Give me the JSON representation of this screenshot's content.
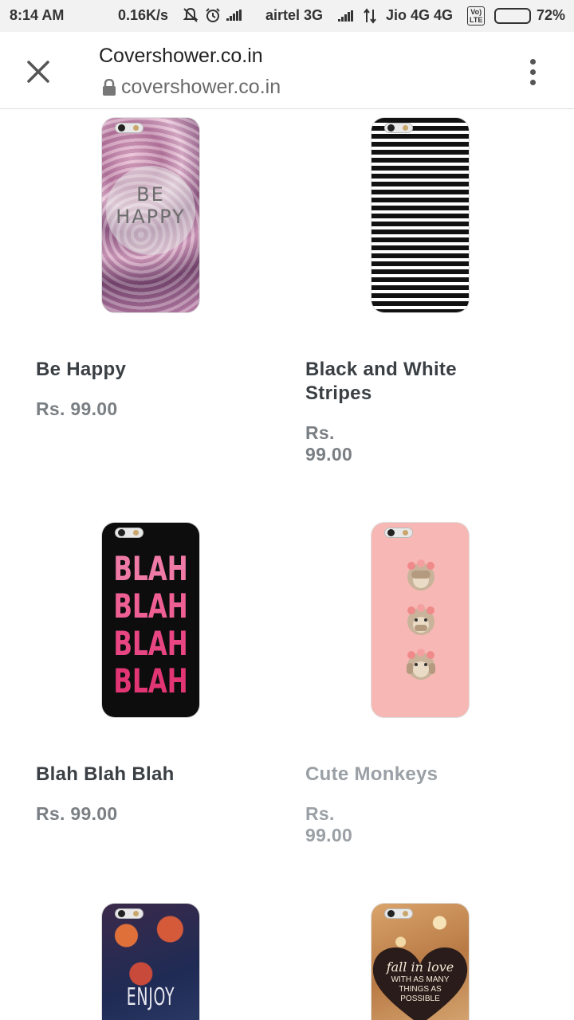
{
  "status_bar": {
    "time": "8:14 AM",
    "speed": "0.16K/s",
    "carrier1": "airtel 3G",
    "carrier2": "Jio 4G 4G",
    "volte_line1": "Vo)",
    "volte_line2": "LTE",
    "battery_pct": "72%",
    "battery_level": 0.72,
    "battery_color": "#f29a0b"
  },
  "browser": {
    "title": "Covershower.co.in",
    "url": "covershower.co.in"
  },
  "products": [
    {
      "name": "Be Happy",
      "price": "Rs. 99.00",
      "case_text": "BE HAPPY"
    },
    {
      "name": "Black and White Stripes",
      "price": "Rs. 99.00"
    },
    {
      "name": "Blah Blah Blah",
      "price": "Rs. 99.00",
      "case_lines": [
        "BLAH",
        "BLAH",
        "BLAH",
        "BLAH"
      ]
    },
    {
      "name": "Cute Monkeys",
      "price": "Rs. 99.00"
    },
    {
      "case_text": "ENJOY"
    },
    {
      "case_line1": "fall in love",
      "case_line2": "WITH AS MANY",
      "case_line3": "THINGS AS",
      "case_line4": "POSSIBLE"
    }
  ]
}
